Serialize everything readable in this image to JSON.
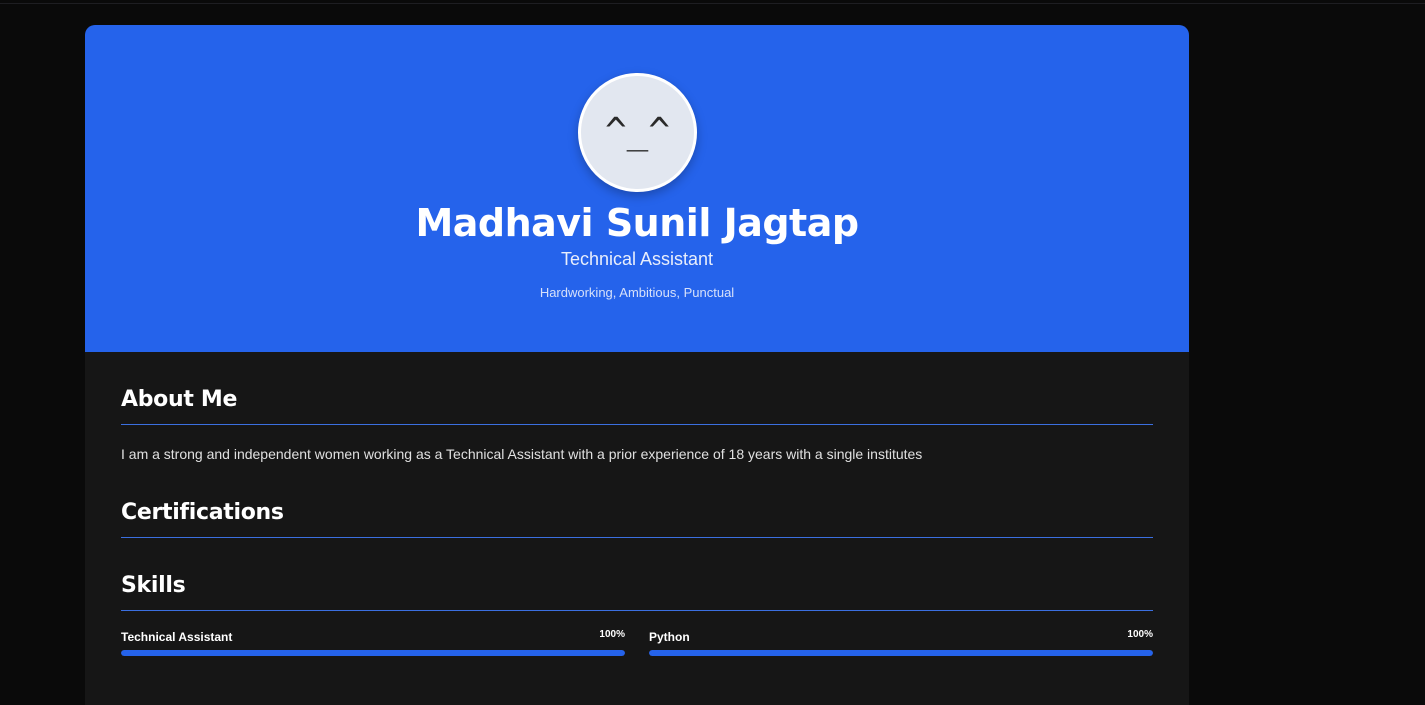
{
  "profile": {
    "avatar_text": "^_^",
    "name": "Madhavi Sunil Jagtap",
    "role": "Technical Assistant",
    "traits": "Hardworking, Ambitious, Punctual"
  },
  "about": {
    "title": "About Me",
    "text": "I am a strong and independent women working as a Technical Assistant with a prior experience of 18 years with a single institutes"
  },
  "certifications": {
    "title": "Certifications"
  },
  "skills": {
    "title": "Skills",
    "items": [
      {
        "name": "Technical Assistant",
        "percent_label": "100%",
        "level": 100
      },
      {
        "name": "Python",
        "percent_label": "100%",
        "level": 100
      }
    ]
  },
  "colors": {
    "accent": "#2563eb",
    "background": "#0a0a0a",
    "card": "#161616"
  }
}
